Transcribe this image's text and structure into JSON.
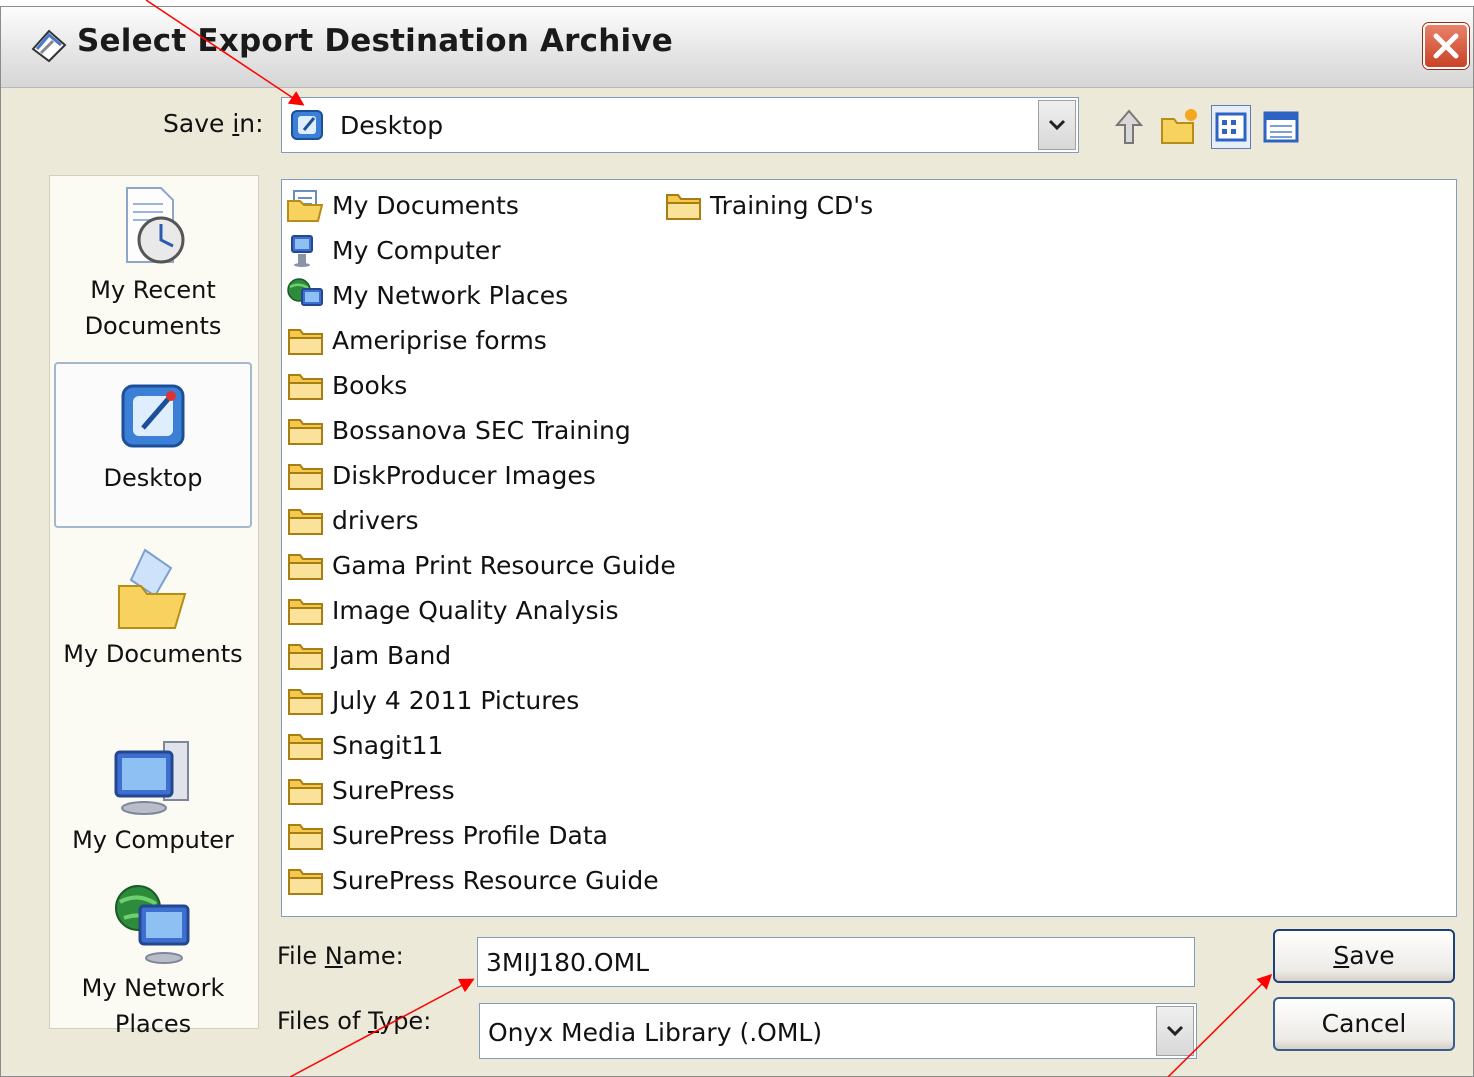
{
  "window": {
    "title": "Select Export Destination Archive"
  },
  "save_in": {
    "label_pre": "Save ",
    "label_underlined": "i",
    "label_post": "n:",
    "value": "Desktop"
  },
  "toolbar": {
    "icons": [
      "up-folder-icon",
      "new-folder-icon",
      "list-view-icon",
      "details-view-icon"
    ]
  },
  "places_bar": {
    "items": [
      {
        "label_line1": "My Recent",
        "label_line2": "Documents"
      },
      {
        "label_line1": "Desktop",
        "label_line2": ""
      },
      {
        "label_line1": "My Documents",
        "label_line2": ""
      },
      {
        "label_line1": "My Computer",
        "label_line2": ""
      },
      {
        "label_line1": "My Network",
        "label_line2": "Places"
      }
    ],
    "selected": "Desktop"
  },
  "files": {
    "column1": [
      {
        "name": "My Documents",
        "icon": "my-documents-icon"
      },
      {
        "name": "My Computer",
        "icon": "my-computer-icon"
      },
      {
        "name": "My Network Places",
        "icon": "network-places-icon"
      },
      {
        "name": "Ameriprise forms",
        "icon": "folder-icon"
      },
      {
        "name": "Books",
        "icon": "folder-icon"
      },
      {
        "name": "Bossanova SEC Training",
        "icon": "folder-icon"
      },
      {
        "name": "DiskProducer Images",
        "icon": "folder-icon"
      },
      {
        "name": "drivers",
        "icon": "folder-icon"
      },
      {
        "name": "Gama Print Resource Guide",
        "icon": "folder-icon"
      },
      {
        "name": "Image Quality Analysis",
        "icon": "folder-icon"
      },
      {
        "name": "Jam Band",
        "icon": "folder-icon"
      },
      {
        "name": "July 4 2011 Pictures",
        "icon": "folder-icon"
      },
      {
        "name": "Snagit11",
        "icon": "folder-icon"
      },
      {
        "name": "SurePress",
        "icon": "folder-icon"
      },
      {
        "name": "SurePress Profile Data",
        "icon": "folder-icon"
      },
      {
        "name": "SurePress Resource Guide",
        "icon": "folder-icon"
      }
    ],
    "column2": [
      {
        "name": "Training CD's",
        "icon": "folder-icon"
      }
    ]
  },
  "file_name": {
    "label_pre": "File ",
    "label_underlined": "N",
    "label_post": "ame:",
    "value": "3MIJ180.OML"
  },
  "file_type": {
    "label_pre": "Files of ",
    "label_underlined": "T",
    "label_post": "ype:",
    "value": "Onyx Media Library (.OML)"
  },
  "buttons": {
    "save_underlined": "S",
    "save_rest": "ave",
    "cancel": "Cancel"
  },
  "colors": {
    "dialog_bg": "#ece9d8",
    "annotation_arrow": "#ff0000",
    "button_border": "#1f3f7a"
  }
}
